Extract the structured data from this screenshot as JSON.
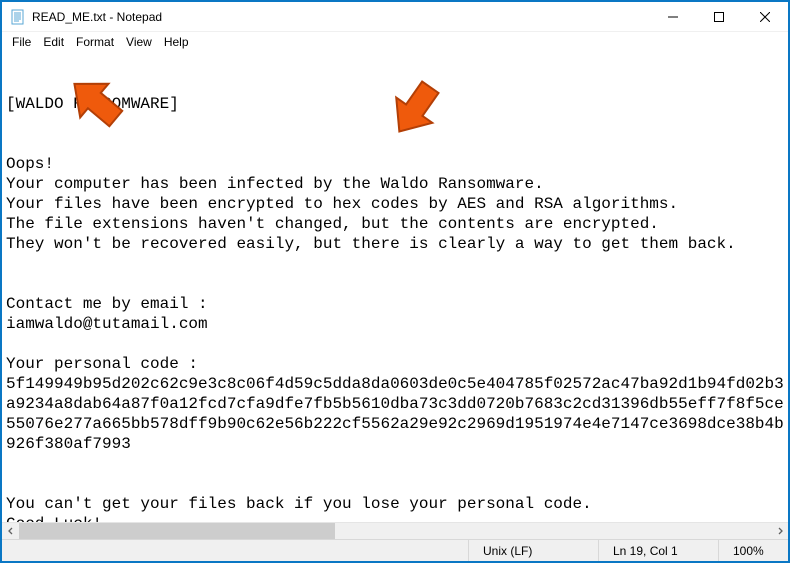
{
  "window": {
    "title": "READ_ME.txt - Notepad"
  },
  "menu": {
    "file": "File",
    "edit": "Edit",
    "format": "Format",
    "view": "View",
    "help": "Help"
  },
  "document": {
    "lines": [
      "[WALDO RANSOMWARE]",
      "",
      "",
      "Oops!",
      "Your computer has been infected by the Waldo Ransomware.",
      "Your files have been encrypted to hex codes by AES and RSA algorithms.",
      "The file extensions haven't changed, but the contents are encrypted.",
      "They won't be recovered easily, but there is clearly a way to get them back.",
      "",
      "",
      "Contact me by email :",
      "iamwaldo@tutamail.com",
      "",
      "Your personal code :",
      "5f149949b95d202c62c9e3c8c06f4d59c5dda8da0603de0c5e404785f02572ac47ba92d1b94fd02b3a9234a8dab64a87f0a12fcd7cfa9dfe7fb5b5610dba73c3dd0720b7683c2cd31396db55eff7f8f5ce55076e277a665bb578dff9b90c62e56b222cf5562a29e92c2969d1951974e4e7147ce3698dce38b4b926f380af7993",
      "",
      "",
      "You can't get your files back if you lose your personal code.",
      "Good Luck!"
    ]
  },
  "status": {
    "encoding": "Unix (LF)",
    "position": "Ln 19, Col 1",
    "zoom": "100%"
  },
  "colors": {
    "arrow": "#ef5a0c"
  }
}
